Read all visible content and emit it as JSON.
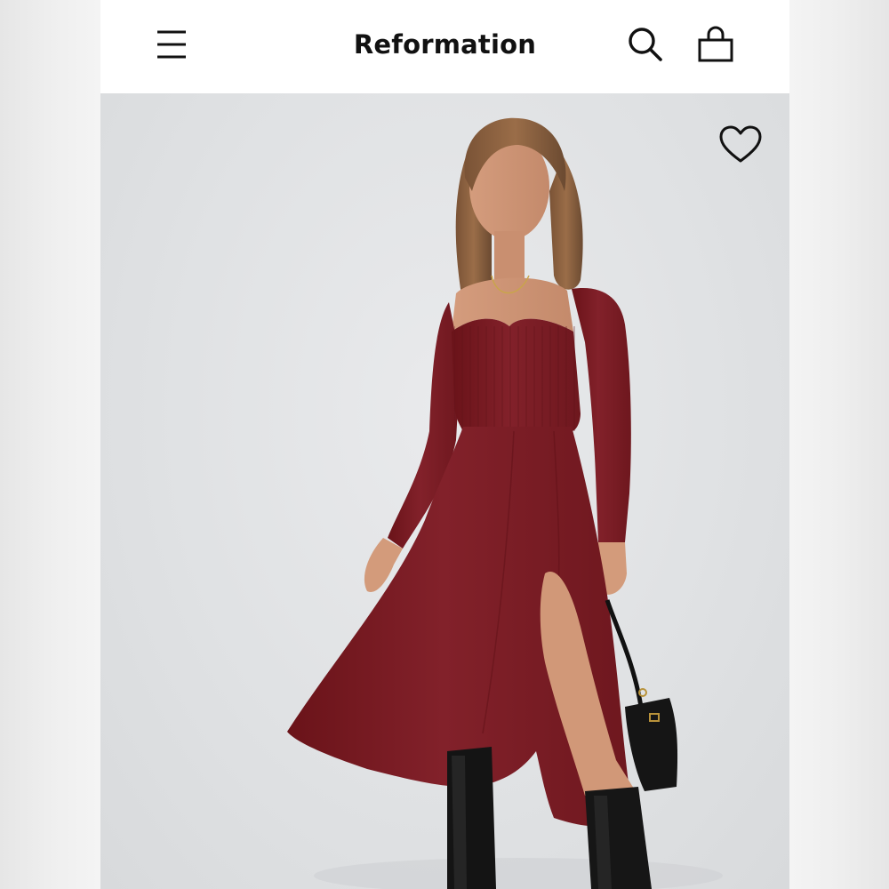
{
  "header": {
    "brand": "Reformation",
    "menu_icon": "hamburger-menu-icon",
    "search_icon": "search-icon",
    "bag_icon": "shopping-bag-icon"
  },
  "product": {
    "image_subject": "model-in-red-midi-dress",
    "wishlist_icon": "heart-outline-icon",
    "dress_color": "#7c1d24"
  },
  "colors": {
    "header_bg": "#ffffff",
    "text": "#111111",
    "image_bg": "#dfe1e3"
  }
}
